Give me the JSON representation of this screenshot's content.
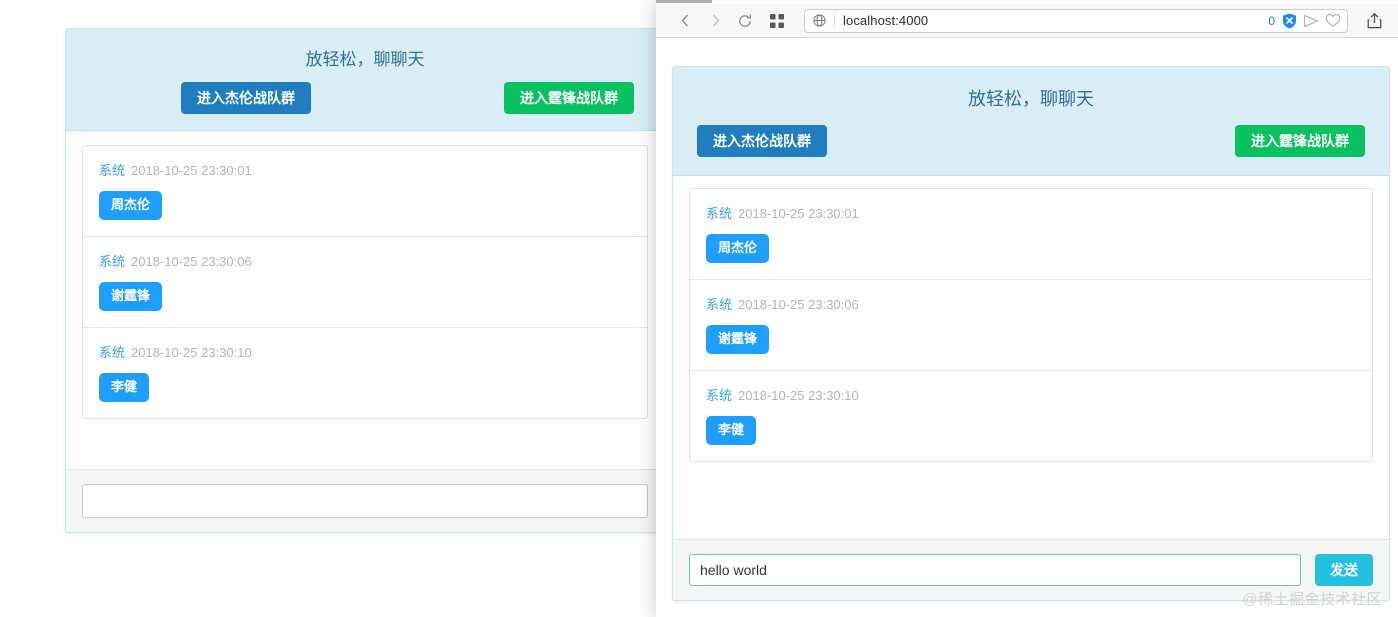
{
  "browser": {
    "nav": {
      "back_icon": "chevron-left-icon",
      "forward_icon": "chevron-right-icon",
      "reload_icon": "reload-icon",
      "grid_icon": "grid-apps-icon"
    },
    "address_bar": {
      "globe_icon": "globe-icon",
      "url": "localhost:4000",
      "placeholder": "Search or enter website name",
      "block_count": "0",
      "shield_icon": "shield-block-icon",
      "send_icon": "paper-plane-icon",
      "heart_icon": "heart-icon"
    },
    "share_icon": "share-upload-icon"
  },
  "chat": {
    "title": "放轻松，聊聊天",
    "join_blue_label": "进入杰伦战队群",
    "join_green_label": "进入霆锋战队群",
    "messages": [
      {
        "sender": "系统",
        "time": "2018-10-25 23:30:01",
        "text": "周杰伦"
      },
      {
        "sender": "系统",
        "time": "2018-10-25 23:30:06",
        "text": "谢霆锋"
      },
      {
        "sender": "系统",
        "time": "2018-10-25 23:30:10",
        "text": "李健"
      }
    ],
    "composer": {
      "value": "hello world",
      "placeholder": "",
      "send_label": "发送"
    }
  },
  "background_window": {
    "chat": {
      "title": "放轻松，聊聊天",
      "join_blue_label": "进入杰伦战队群",
      "join_green_label": "进入霆锋战队群",
      "messages": [
        {
          "sender": "系统",
          "time": "2018-10-25 23:30:01",
          "text": "周杰伦"
        },
        {
          "sender": "系统",
          "time": "2018-10-25 23:30:06",
          "text": "谢霆锋"
        },
        {
          "sender": "系统",
          "time": "2018-10-25 23:30:10",
          "text": "李健"
        }
      ],
      "composer": {
        "value": "",
        "placeholder": ""
      }
    }
  },
  "watermark": "@稀土掘金技术社区",
  "colors": {
    "header_bg": "#d9edf7",
    "title": "#31708f",
    "blue_button": "#1f7dc0",
    "green_button": "#08c160",
    "bubble": "#1e9fff",
    "send_button": "#23c0e0",
    "sender": "#3aa1e8",
    "time": "#b4b4b4"
  }
}
